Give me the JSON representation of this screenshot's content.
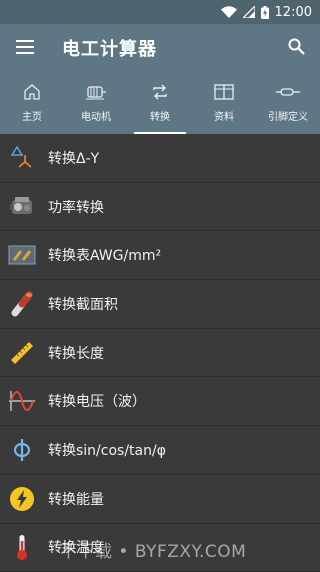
{
  "status_bar": {
    "time": "12:00"
  },
  "app_bar": {
    "title": "电工计算器"
  },
  "tabs": [
    {
      "label": "主页",
      "icon": "home-icon"
    },
    {
      "label": "电动机",
      "icon": "motor-icon"
    },
    {
      "label": "转换",
      "icon": "convert-icon",
      "active": true
    },
    {
      "label": "资料",
      "icon": "book-icon"
    },
    {
      "label": "引脚定义",
      "icon": "pin-icon"
    }
  ],
  "list": [
    {
      "label": "转换Δ-Y",
      "icon": "delta-star-icon"
    },
    {
      "label": "功率转换",
      "icon": "engine-icon"
    },
    {
      "label": "转换表AWG/mm²",
      "icon": "wire-gauge-icon"
    },
    {
      "label": "转换截面积",
      "icon": "cable-cross-section-icon"
    },
    {
      "label": "转换长度",
      "icon": "ruler-icon"
    },
    {
      "label": "转换电压（波）",
      "icon": "sine-wave-icon"
    },
    {
      "label": "转换sin/cos/tan/φ",
      "icon": "phi-icon"
    },
    {
      "label": "转换能量",
      "icon": "lightning-icon"
    },
    {
      "label": "转换温度",
      "icon": "thermometer-icon"
    }
  ],
  "watermark": "不下载 • BYFZXY.COM",
  "colors": {
    "app_bar": "#5f7784",
    "status_bar": "#4e6570",
    "list_background": "#3a3a3a",
    "divider": "#2c2c2c"
  }
}
